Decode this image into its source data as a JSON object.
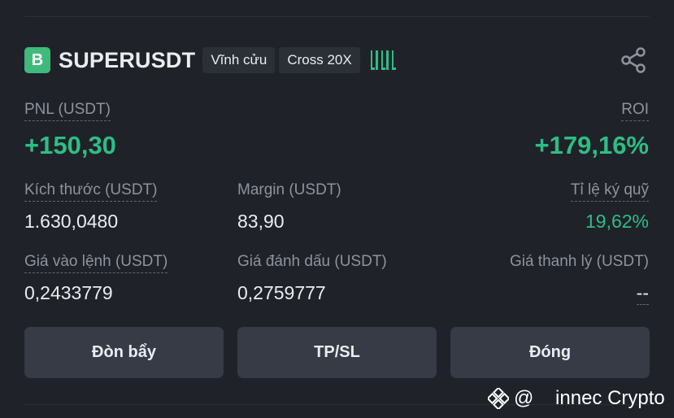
{
  "header": {
    "badge": "B",
    "symbol": "SUPERUSDT",
    "tag_contract": "Vĩnh cửu",
    "tag_margin": "Cross 20X",
    "colors": {
      "accent_green": "#2ebd85",
      "badge_green": "#40b97d"
    }
  },
  "pnl": {
    "label": "PNL (USDT)",
    "value": "+150,30"
  },
  "roi": {
    "label": "ROI",
    "value": "+179,16%"
  },
  "size": {
    "label": "Kích thước (USDT)",
    "value": "1.630,0480"
  },
  "margin": {
    "label": "Margin (USDT)",
    "value": "83,90"
  },
  "margin_ratio": {
    "label": "Tỉ lệ ký quỹ",
    "value": "19,62%"
  },
  "entry_price": {
    "label": "Giá vào lệnh (USDT)",
    "value": "0,2433779"
  },
  "mark_price": {
    "label": "Giá đánh dấu (USDT)",
    "value": "0,2759777"
  },
  "liq_price": {
    "label": "Giá thanh lý (USDT)",
    "value": "--"
  },
  "buttons": {
    "leverage": "Đòn bẩy",
    "tpsl": "TP/SL",
    "close": "Đóng"
  },
  "watermark": {
    "text": "@    innec Crypto"
  }
}
